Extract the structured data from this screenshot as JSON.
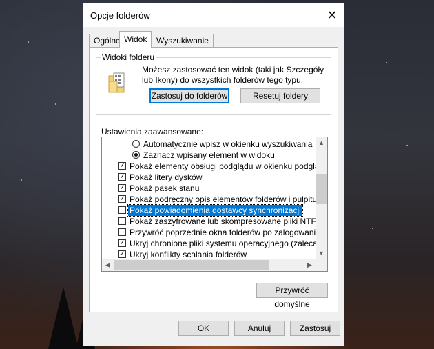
{
  "dialog": {
    "title": "Opcje folderów",
    "close_glyph": "✕"
  },
  "tabs": [
    {
      "label": "Ogólne",
      "active": false
    },
    {
      "label": "Widok",
      "active": true
    },
    {
      "label": "Wyszukiwanie",
      "active": false
    }
  ],
  "folder_views": {
    "label": "Widoki folderu",
    "description": "Możesz zastosować ten widok (taki jak Szczegóły lub Ikony) do wszystkich folderów tego typu.",
    "icon": "folder-views-icon",
    "apply_button": "Zastosuj do folderów",
    "reset_button": "Resetuj foldery"
  },
  "advanced": {
    "label": "Ustawienia zaawansowane:",
    "items": [
      {
        "type": "radio",
        "checked": false,
        "text": "Automatycznie wpisz w okienku wyszukiwania"
      },
      {
        "type": "radio",
        "checked": true,
        "text": "Zaznacz wpisany element w widoku"
      },
      {
        "type": "checkbox",
        "checked": true,
        "text": "Pokaż elementy obsługi podglądu w okienku podglądu"
      },
      {
        "type": "checkbox",
        "checked": true,
        "text": "Pokaż litery dysków"
      },
      {
        "type": "checkbox",
        "checked": true,
        "text": "Pokaż pasek stanu"
      },
      {
        "type": "checkbox",
        "checked": true,
        "text": "Pokaż podręczny opis elementów folderów i pulpitu"
      },
      {
        "type": "checkbox",
        "checked": false,
        "selected": true,
        "text": "Pokaż powiadomienia dostawcy synchronizacji"
      },
      {
        "type": "checkbox",
        "checked": false,
        "text": "Pokaż zaszyfrowane lub skompresowane pliki NTFS w kolorze"
      },
      {
        "type": "checkbox",
        "checked": false,
        "text": "Przywróć poprzednie okna folderów po zalogowaniu"
      },
      {
        "type": "checkbox",
        "checked": true,
        "text": "Ukryj chronione pliki systemu operacyjnego (zalecane)"
      },
      {
        "type": "checkbox",
        "checked": true,
        "text": "Ukryj konflikty scalania folderów"
      }
    ]
  },
  "restore_defaults": "Przywróć domyślne",
  "footer": {
    "ok": "OK",
    "cancel": "Anuluj",
    "apply": "Zastosuj"
  }
}
